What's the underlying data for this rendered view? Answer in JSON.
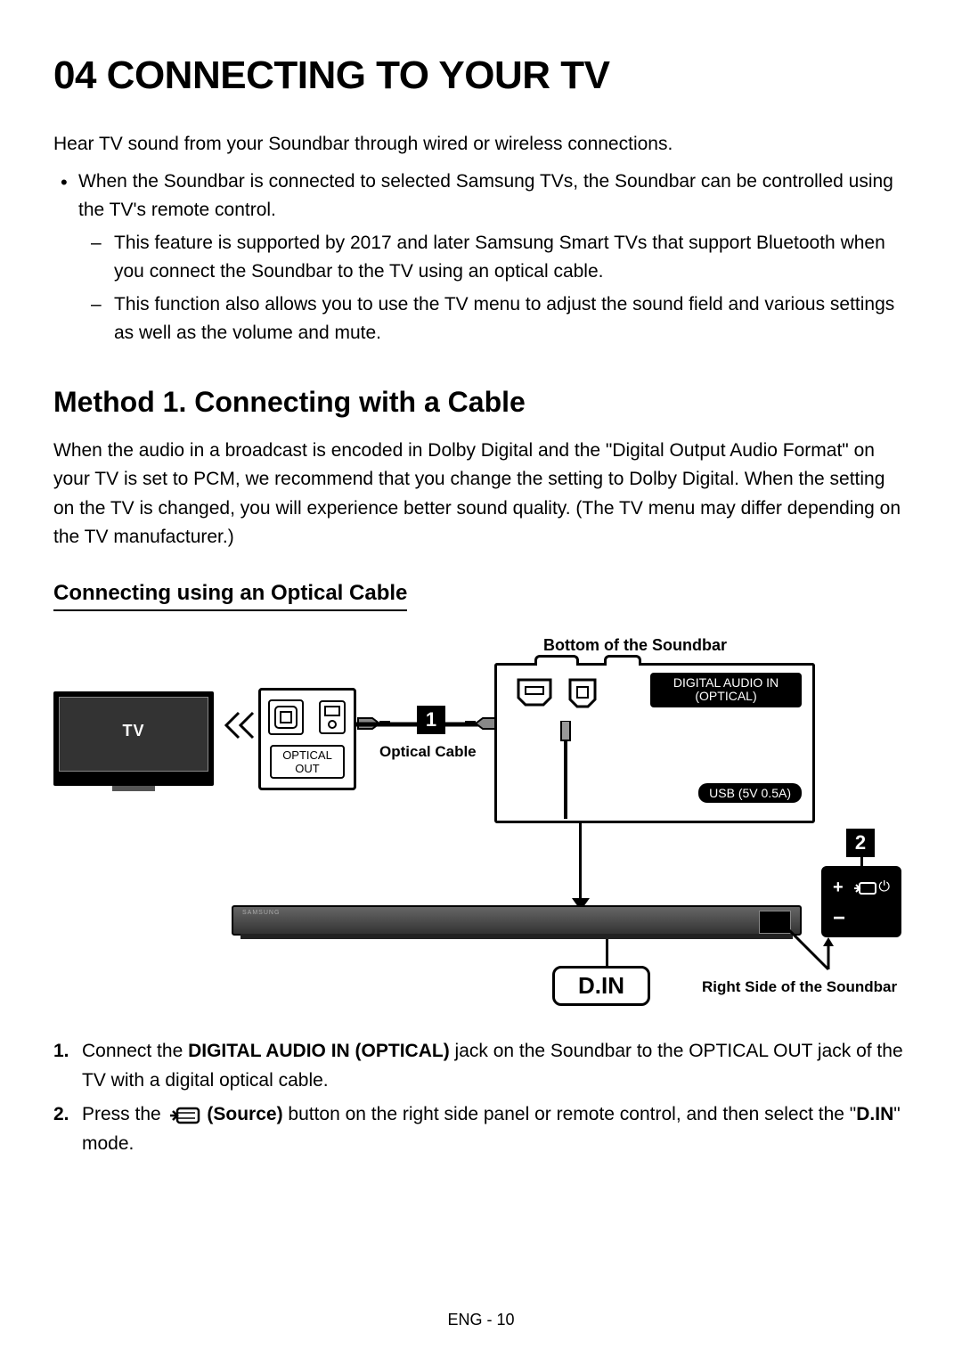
{
  "heading": "04   CONNECTING TO YOUR TV",
  "intro": "Hear TV sound from your Soundbar through wired or wireless connections.",
  "bullet1": "When the Soundbar is connected to selected Samsung TVs, the Soundbar can be controlled using the TV's remote control.",
  "dash1": "This feature is supported by 2017 and later Samsung Smart TVs that support Bluetooth when you connect the Soundbar to the TV using an optical cable.",
  "dash2": "This function also allows you to use the TV menu to adjust the sound field and various settings as well as the volume and mute.",
  "method_heading": "Method 1. Connecting with a Cable",
  "method_desc": "When the audio in a broadcast is encoded in Dolby Digital and the \"Digital Output Audio Format\" on your TV is set to PCM, we recommend that you change the setting to Dolby Digital. When the setting on the TV is changed, you will experience better sound quality. (The TV menu may differ depending on the TV manufacturer.)",
  "sub_heading": "Connecting using an Optical Cable",
  "diagram": {
    "bottom_soundbar_label": "Bottom of the Soundbar",
    "tv_label": "TV",
    "optical_out": "OPTICAL OUT",
    "optical_cable": "Optical Cable",
    "digital_audio_in_line1": "DIGITAL AUDIO IN",
    "digital_audio_in_line2": "(OPTICAL)",
    "usb_label": "USB (5V 0.5A)",
    "badge1": "1",
    "badge2": "2",
    "din": "D.IN",
    "right_side_label": "Right Side of the Soundbar",
    "plus": "+",
    "minus": "−",
    "power": "⏻",
    "brand": "SAMSUNG"
  },
  "steps": {
    "s1_num": "1.",
    "s1_a": "Connect the ",
    "s1_bold": "DIGITAL AUDIO IN (OPTICAL)",
    "s1_b": " jack on the Soundbar to the OPTICAL OUT jack of the TV with a digital optical cable.",
    "s2_num": "2.",
    "s2_a": "Press the ",
    "s2_bold": " (Source)",
    "s2_b": " button on the right side panel or remote control, and then select the \"",
    "s2_bold2": "D.IN",
    "s2_c": "\" mode."
  },
  "footer": "ENG - 10"
}
